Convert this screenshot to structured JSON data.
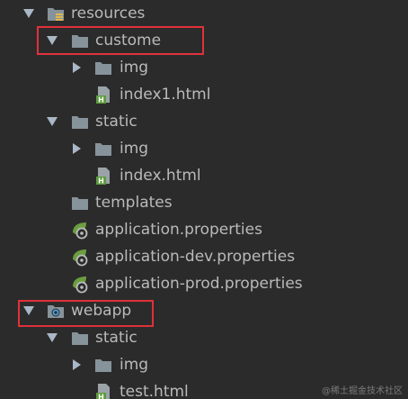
{
  "project_tree": {
    "items": [
      {
        "label": "resources",
        "type": "resources-folder",
        "expanded": true
      },
      {
        "label": "custome",
        "type": "folder",
        "expanded": true
      },
      {
        "label": "img",
        "type": "folder",
        "expanded": false
      },
      {
        "label": "index1.html",
        "type": "html-file"
      },
      {
        "label": "static",
        "type": "folder",
        "expanded": true
      },
      {
        "label": "img",
        "type": "folder",
        "expanded": false
      },
      {
        "label": "index.html",
        "type": "html-file"
      },
      {
        "label": "templates",
        "type": "folder"
      },
      {
        "label": "application.properties",
        "type": "spring-properties-file"
      },
      {
        "label": "application-dev.properties",
        "type": "spring-properties-file"
      },
      {
        "label": "application-prod.properties",
        "type": "spring-properties-file"
      },
      {
        "label": "webapp",
        "type": "web-folder",
        "expanded": true
      },
      {
        "label": "static",
        "type": "folder",
        "expanded": true
      },
      {
        "label": "img",
        "type": "folder",
        "expanded": false
      },
      {
        "label": "test.html",
        "type": "html-file"
      }
    ],
    "highlighted": [
      "custome",
      "webapp"
    ]
  },
  "colors": {
    "background": "#2b2b2b",
    "text": "#bababa",
    "folder": "#87939a",
    "arrow": "#a9b7c6",
    "html_badge": "#5d9b3c",
    "spring": "#6a9e3f",
    "highlight_border": "#e0313a",
    "resources_marker": "#e0b94b",
    "web_marker": "#4a9fd8"
  },
  "watermark": "@稀土掘金技术社区"
}
